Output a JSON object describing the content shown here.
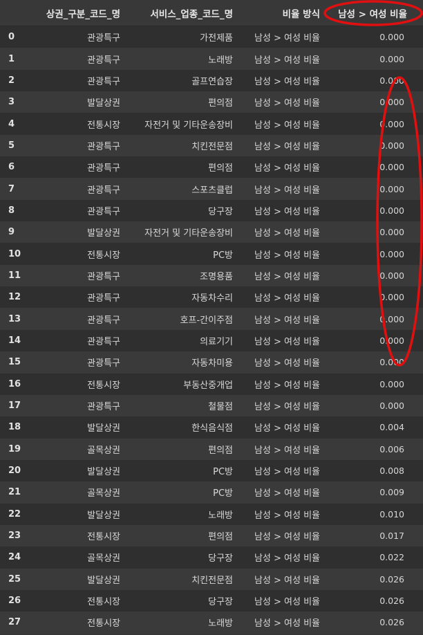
{
  "table": {
    "columns": {
      "index": "",
      "area": "상권_구분_코드_명",
      "service": "서비스_업종_코드_명",
      "method": "비율 방식",
      "ratio": "남성 > 여성 비율"
    },
    "rows": [
      {
        "idx": "0",
        "area": "관광특구",
        "service": "가전제품",
        "method": "남성 > 여성 비율",
        "ratio": "0.000"
      },
      {
        "idx": "1",
        "area": "관광특구",
        "service": "노래방",
        "method": "남성 > 여성 비율",
        "ratio": "0.000"
      },
      {
        "idx": "2",
        "area": "관광특구",
        "service": "골프연습장",
        "method": "남성 > 여성 비율",
        "ratio": "0.000"
      },
      {
        "idx": "3",
        "area": "발달상권",
        "service": "편의점",
        "method": "남성 > 여성 비율",
        "ratio": "0.000"
      },
      {
        "idx": "4",
        "area": "전통시장",
        "service": "자전거 및 기타운송장비",
        "method": "남성 > 여성 비율",
        "ratio": "0.000"
      },
      {
        "idx": "5",
        "area": "관광특구",
        "service": "치킨전문점",
        "method": "남성 > 여성 비율",
        "ratio": "0.000"
      },
      {
        "idx": "6",
        "area": "관광특구",
        "service": "편의점",
        "method": "남성 > 여성 비율",
        "ratio": "0.000"
      },
      {
        "idx": "7",
        "area": "관광특구",
        "service": "스포츠클럽",
        "method": "남성 > 여성 비율",
        "ratio": "0.000"
      },
      {
        "idx": "8",
        "area": "관광특구",
        "service": "당구장",
        "method": "남성 > 여성 비율",
        "ratio": "0.000"
      },
      {
        "idx": "9",
        "area": "발달상권",
        "service": "자전거 및 기타운송장비",
        "method": "남성 > 여성 비율",
        "ratio": "0.000"
      },
      {
        "idx": "10",
        "area": "전통시장",
        "service": "PC방",
        "method": "남성 > 여성 비율",
        "ratio": "0.000"
      },
      {
        "idx": "11",
        "area": "관광특구",
        "service": "조명용품",
        "method": "남성 > 여성 비율",
        "ratio": "0.000"
      },
      {
        "idx": "12",
        "area": "관광특구",
        "service": "자동차수리",
        "method": "남성 > 여성 비율",
        "ratio": "0.000"
      },
      {
        "idx": "13",
        "area": "관광특구",
        "service": "호프-간이주점",
        "method": "남성 > 여성 비율",
        "ratio": "0.000"
      },
      {
        "idx": "14",
        "area": "관광특구",
        "service": "의료기기",
        "method": "남성 > 여성 비율",
        "ratio": "0.000"
      },
      {
        "idx": "15",
        "area": "관광특구",
        "service": "자동차미용",
        "method": "남성 > 여성 비율",
        "ratio": "0.000"
      },
      {
        "idx": "16",
        "area": "전통시장",
        "service": "부동산중개업",
        "method": "남성 > 여성 비율",
        "ratio": "0.000"
      },
      {
        "idx": "17",
        "area": "관광특구",
        "service": "철물점",
        "method": "남성 > 여성 비율",
        "ratio": "0.000"
      },
      {
        "idx": "18",
        "area": "발달상권",
        "service": "한식음식점",
        "method": "남성 > 여성 비율",
        "ratio": "0.004"
      },
      {
        "idx": "19",
        "area": "골목상권",
        "service": "편의점",
        "method": "남성 > 여성 비율",
        "ratio": "0.006"
      },
      {
        "idx": "20",
        "area": "발달상권",
        "service": "PC방",
        "method": "남성 > 여성 비율",
        "ratio": "0.008"
      },
      {
        "idx": "21",
        "area": "골목상권",
        "service": "PC방",
        "method": "남성 > 여성 비율",
        "ratio": "0.009"
      },
      {
        "idx": "22",
        "area": "발달상권",
        "service": "노래방",
        "method": "남성 > 여성 비율",
        "ratio": "0.010"
      },
      {
        "idx": "23",
        "area": "전통시장",
        "service": "편의점",
        "method": "남성 > 여성 비율",
        "ratio": "0.017"
      },
      {
        "idx": "24",
        "area": "골목상권",
        "service": "당구장",
        "method": "남성 > 여성 비율",
        "ratio": "0.022"
      },
      {
        "idx": "25",
        "area": "발달상권",
        "service": "치킨전문점",
        "method": "남성 > 여성 비율",
        "ratio": "0.026"
      },
      {
        "idx": "26",
        "area": "전통시장",
        "service": "당구장",
        "method": "남성 > 여성 비율",
        "ratio": "0.026"
      },
      {
        "idx": "27",
        "area": "전통시장",
        "service": "노래방",
        "method": "남성 > 여성 비율",
        "ratio": "0.026"
      }
    ]
  },
  "annotations": {
    "color": "#e01010",
    "shapes": [
      "header-ellipse",
      "ratio-zero-ellipse"
    ]
  },
  "colors": {
    "background": "#383838",
    "row_odd": "#2f2f2f",
    "row_even": "#3a3a3a",
    "text": "#d8d8d8"
  }
}
